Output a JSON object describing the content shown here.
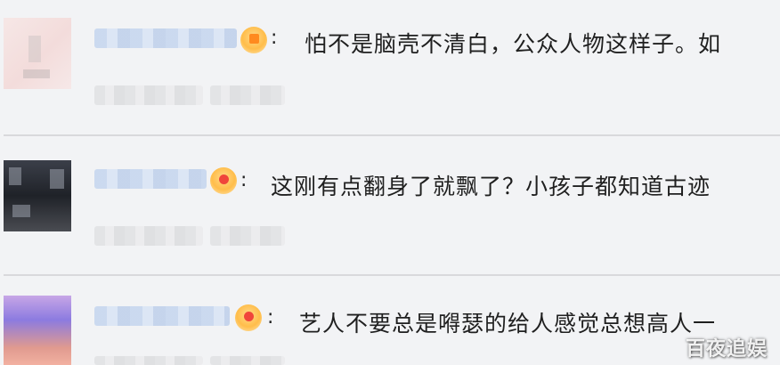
{
  "comments": [
    {
      "colon": ":",
      "text": "怕不是脑壳不清白，公众人物这样子。如",
      "badge_color": "#ff8a1f"
    },
    {
      "colon": ":",
      "text": "这刚有点翻身了就飘了？小孩子都知道古迹",
      "badge_color": "#f0443b"
    },
    {
      "colon": ":",
      "text": "艺人不要总是嘚瑟的给人感觉总想高人一",
      "badge_color": "#f0443b"
    }
  ],
  "watermark": {
    "text": "百夜追娱"
  }
}
